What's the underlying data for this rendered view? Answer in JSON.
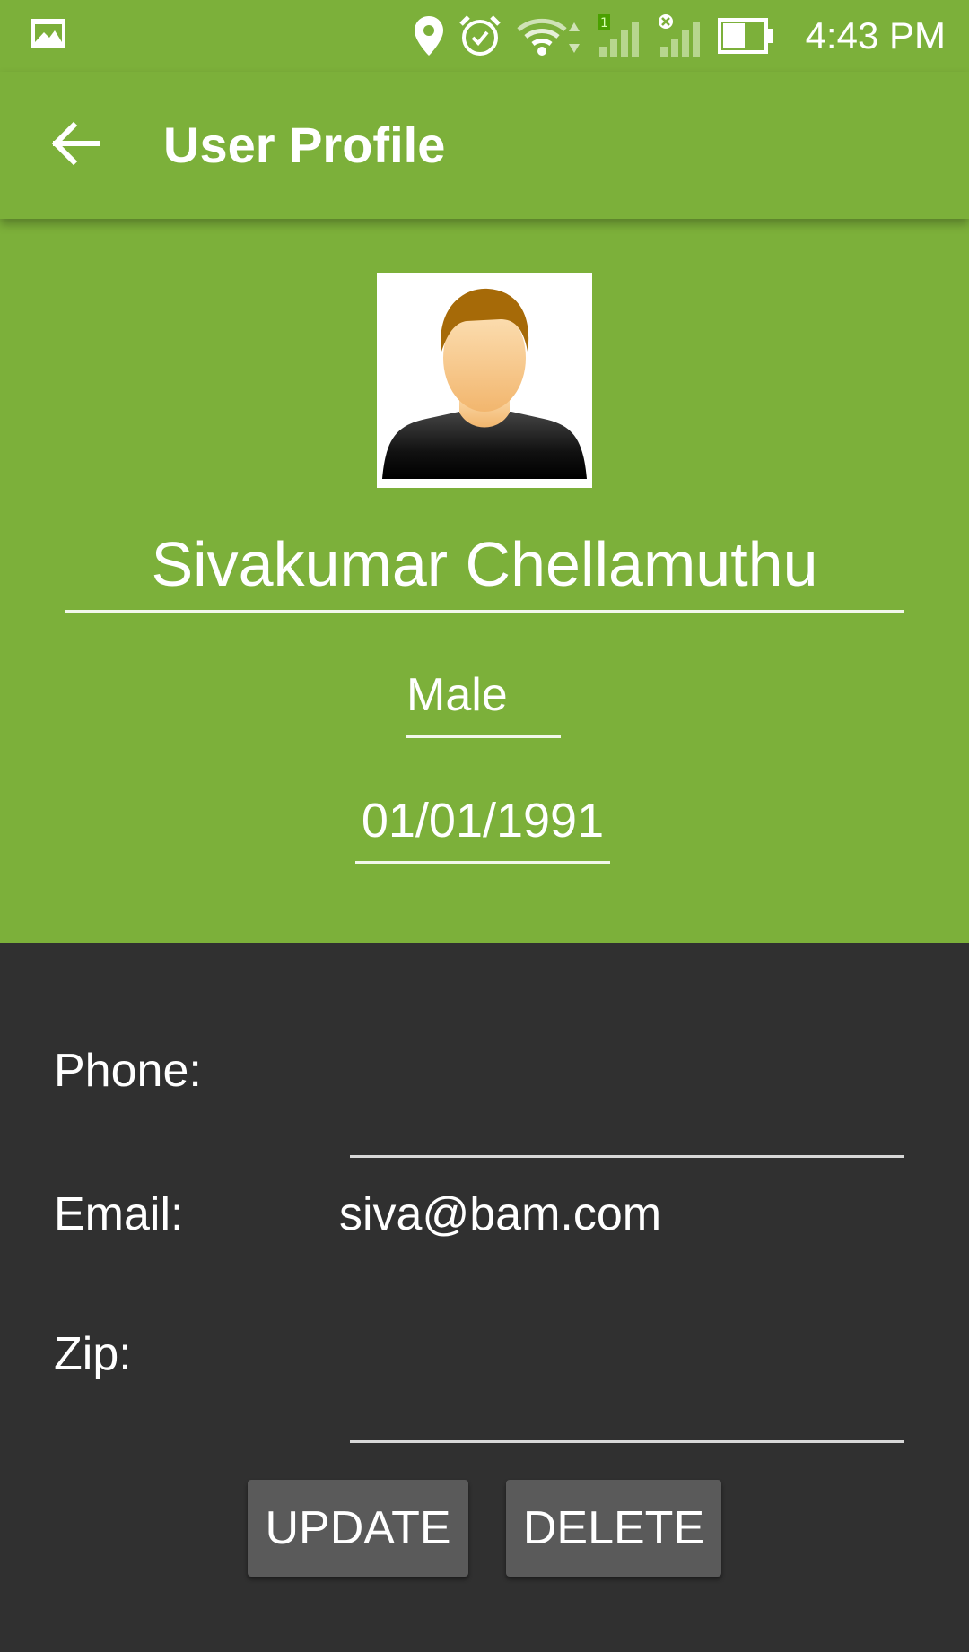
{
  "status_bar": {
    "time": "4:43 PM",
    "icons": [
      "gallery-icon",
      "location-icon",
      "alarm-icon",
      "wifi-icon",
      "signal-sim1-icon",
      "signal-sim2-no-service-icon",
      "battery-icon"
    ]
  },
  "app_bar": {
    "title": "User Profile",
    "back_icon": "arrow-back-icon"
  },
  "profile": {
    "name": "Sivakumar Chellamuthu",
    "gender": "Male",
    "dob": "01/01/1991",
    "avatar_icon": "person-avatar-icon"
  },
  "form": {
    "phone_label": "Phone:",
    "phone_value": "",
    "email_label": "Email:",
    "email_value": "siva@bam.com",
    "zip_label": "Zip:",
    "zip_value": ""
  },
  "buttons": {
    "update": "UPDATE",
    "delete": "DELETE"
  },
  "colors": {
    "primary": "#7CB03A",
    "background": "#303030",
    "button": "#5A5A5A"
  }
}
